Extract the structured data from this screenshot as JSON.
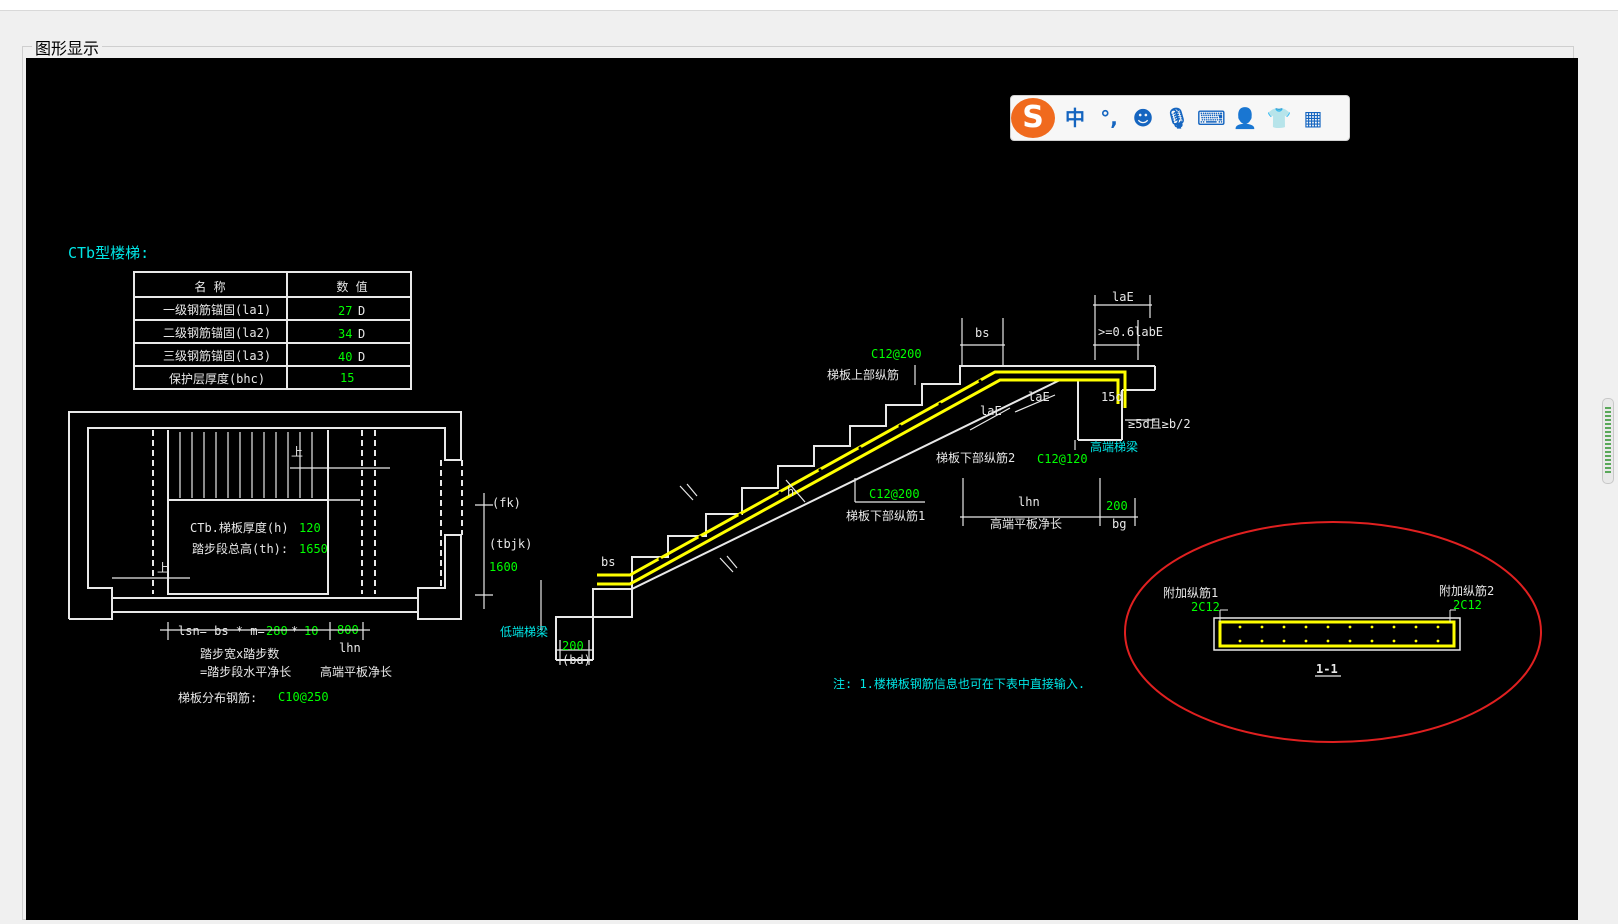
{
  "panel": {
    "title": "图形显示"
  },
  "ime": {
    "logo": "S",
    "mode": "中",
    "punct": "°,"
  },
  "drawing": {
    "title": "CTb型楼梯:",
    "table": {
      "headers": [
        "名 称",
        "数 值"
      ],
      "rows": [
        {
          "name": "一级钢筋锚固(la1)",
          "value": "27",
          "unit": "D"
        },
        {
          "name": "二级钢筋锚固(la2)",
          "value": "34",
          "unit": "D"
        },
        {
          "name": "三级钢筋锚固(la3)",
          "value": "40",
          "unit": "D"
        },
        {
          "name": "保护层厚度(bhc)",
          "value": "15",
          "unit": ""
        }
      ]
    },
    "plan": {
      "thickness_label": "CTb.梯板厚度(h)",
      "thickness_value": "120",
      "height_label": "踏步段总高(th):",
      "height_value": "1650",
      "up1": "上",
      "up2": "上",
      "fk": "(fk)",
      "tbjk": "(tbjk)",
      "tbjk_value": "1600",
      "lsn_label": "lsn= bs * m=",
      "bs_value": "280",
      "m_value": "10",
      "lhn_value": "800",
      "lhn": "lhn",
      "step_text": "踏步宽x踏步数",
      "eq_text": "=踏步段水平净长",
      "high_plate_text": "高端平板净长",
      "distribution_label": "梯板分布钢筋:",
      "distribution_value": "C10@250"
    },
    "section": {
      "upper_rebar_value": "C12@200",
      "upper_rebar_label": "梯板上部纵筋",
      "bs_top": "bs",
      "laE_top": "laE",
      "labE_text": ">=0.6labE",
      "laE_1": "laE",
      "laE_2": "laE",
      "d15": "15d",
      "d5_text": "≥5d且≥b/2",
      "high_beam": "高端梯梁",
      "lower2_label": "梯板下部纵筋2",
      "lower2_value": "C12@120",
      "lower1_value": "C12@200",
      "lower1_label": "梯板下部纵筋1",
      "lhn": "lhn",
      "high_plate_text": "高端平板净长",
      "bg_value": "200",
      "bg": "bg",
      "h": "h",
      "bs_bottom": "bs",
      "low_beam": "低端梯梁",
      "bd_value": "200",
      "bd": "(bd)",
      "note": "注: 1.楼梯板钢筋信息也可在下表中直接输入."
    },
    "cross_section": {
      "extra1_label": "附加纵筋1",
      "extra1_value": "2C12",
      "extra2_label": "附加纵筋2",
      "extra2_value": "2C12",
      "section_label": "1-1"
    }
  },
  "colors": {
    "cyan": "#00e5e5",
    "green": "#00ff00",
    "yellow": "#ffff00",
    "white": "#e8e8e8",
    "red": "#e02020"
  }
}
